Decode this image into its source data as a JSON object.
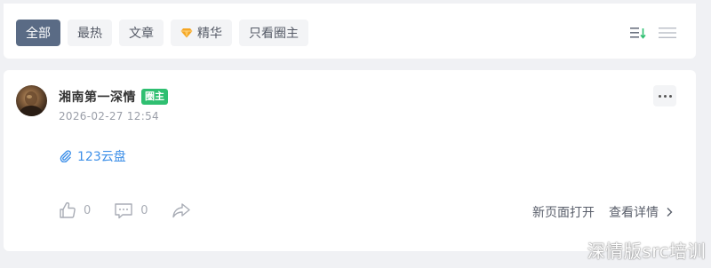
{
  "filters": {
    "tabs": [
      {
        "label": "全部",
        "active": true
      },
      {
        "label": "最热",
        "active": false
      },
      {
        "label": "文章",
        "active": false
      },
      {
        "label": "精华",
        "active": false,
        "icon": "gem-icon"
      },
      {
        "label": "只看圈主",
        "active": false
      }
    ]
  },
  "post": {
    "author": "湘南第一深情",
    "badge": "圈主",
    "time": "2026-02-27 12:54",
    "attachment": "123云盘",
    "likes": "0",
    "comments": "0",
    "open_new": "新页面打开",
    "view_detail": "查看详情"
  },
  "watermark": "深情版src培训",
  "colors": {
    "active_tab": "#5a6b85",
    "badge": "#2fbf71",
    "link": "#3d8fe8",
    "page_bg": "#f0f1f4"
  }
}
